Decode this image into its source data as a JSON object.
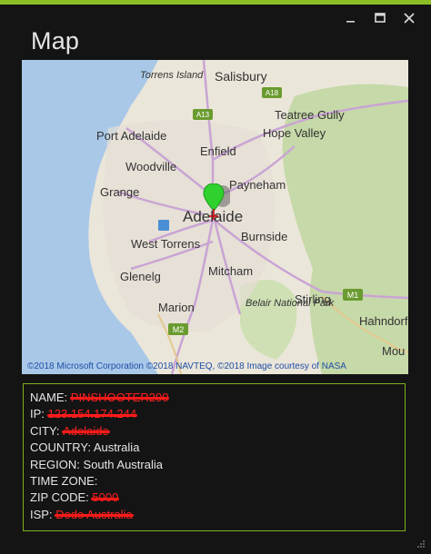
{
  "window": {
    "title": "Map",
    "controls": {
      "minimize_icon": "minimize-icon",
      "maximize_icon": "maximize-icon",
      "close_icon": "close-icon"
    },
    "accent_color": "#8cbf26"
  },
  "map": {
    "copyright": "©2018 Microsoft Corporation ©2018 NAVTEQ, ©2018 Image courtesy of NASA",
    "pin_color": "#2fd12f",
    "places": {
      "torrens_island": "Torrens Island",
      "salisbury": "Salisbury",
      "teatree_gully": "Teatree Gully",
      "port_adelaide": "Port Adelaide",
      "hope_valley": "Hope Valley",
      "enfield": "Enfield",
      "woodville": "Woodville",
      "payneham": "Payneham",
      "grange": "Grange",
      "adelaide": "Adelaide",
      "burnside": "Burnside",
      "west_torrens": "West Torrens",
      "glenelg": "Glenelg",
      "mitcham": "Mitcham",
      "belair_national_park": "Belair National Park",
      "stirling": "Stirling",
      "marion": "Marion",
      "hahndorf": "Hahndorf",
      "mount": "Mou"
    },
    "road_shields": [
      "A13",
      "A18",
      "M1",
      "M2"
    ]
  },
  "info": {
    "name_label": "NAME:",
    "name_value": "PINSHOOTER200",
    "ip_label": "IP:",
    "ip_value": "123.154.174.244",
    "city_label": "CITY:",
    "city_value": "Adelaide",
    "country_label": "COUNTRY:",
    "country_value": "Australia",
    "region_label": "REGION:",
    "region_value": "South Australia",
    "timezone_label": "TIME ZONE:",
    "timezone_value": "",
    "zip_label": "ZIP CODE:",
    "zip_value": "5000",
    "isp_label": "ISP:",
    "isp_value": "Dodo Australia"
  }
}
